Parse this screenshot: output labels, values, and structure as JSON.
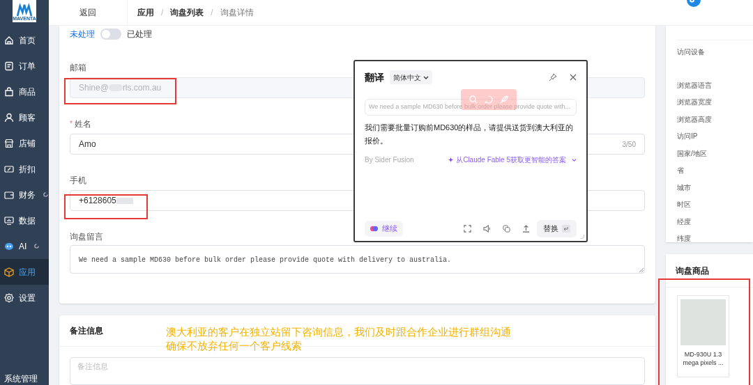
{
  "sidebar": {
    "logo": "MAVENTA",
    "items": [
      {
        "label": "首页",
        "kind": "home",
        "selected": false,
        "loading": false
      },
      {
        "label": "订单",
        "kind": "order",
        "selected": false,
        "loading": false
      },
      {
        "label": "商品",
        "kind": "bag",
        "selected": false,
        "loading": false
      },
      {
        "label": "顾客",
        "kind": "user",
        "selected": false,
        "loading": false
      },
      {
        "label": "店铺",
        "kind": "shop",
        "selected": false,
        "loading": false
      },
      {
        "label": "折扣",
        "kind": "discount",
        "selected": false,
        "loading": false
      },
      {
        "label": "财务",
        "kind": "wallet",
        "selected": false,
        "loading": true
      },
      {
        "label": "数据",
        "kind": "monitor",
        "selected": false,
        "loading": false
      },
      {
        "label": "AI",
        "kind": "robot",
        "selected": false,
        "loading": true
      },
      {
        "label": "应用",
        "kind": "cube",
        "selected": true,
        "loading": false
      },
      {
        "label": "设置",
        "kind": "gear",
        "selected": false,
        "loading": false
      }
    ],
    "footer": "系统管理"
  },
  "header": {
    "back": "返回",
    "separator": "/",
    "breadcrumb": [
      {
        "label": "应用",
        "current": false
      },
      {
        "label": "询盘列表",
        "current": false
      },
      {
        "label": "询盘详情",
        "current": true
      }
    ]
  },
  "status_switch": {
    "off_label": "未处理",
    "on_label": "已处理",
    "on": false
  },
  "form": {
    "email": {
      "label": "邮箱",
      "value_start": "Shine@",
      "value_end": "rls.com.au",
      "disabled": true
    },
    "name": {
      "label": "姓名",
      "required_mark": "*",
      "value": "Amo",
      "counter": "3/50"
    },
    "phone": {
      "label": "手机",
      "value_start": "+6128605"
    },
    "message": {
      "label": "询盘留言",
      "value": "We need a sample MD630 before bulk order please provide quote with delivery to australia."
    }
  },
  "notes": {
    "title": "备注信息",
    "placeholder": "备注信息"
  },
  "visit_info": {
    "items": [
      "访问设备",
      "浏览器语言",
      "浏览器宽度",
      "浏览器高度",
      "访问IP",
      "国家/地区",
      "省",
      "城市",
      "时区",
      "经度",
      "纬度"
    ]
  },
  "product_panel": {
    "title": "询盘商品",
    "products": [
      {
        "name": "MD-930U 1.3 mega pixels ..."
      }
    ]
  },
  "translate_popup": {
    "title": "翻译",
    "language": "简体中文",
    "source": "We need a sample MD630 before bulk order please provide quote with...",
    "result": "我们需要批量订购前MD630的样品，请提供送货到澳大利亚的报价。",
    "credit": "By Sider Fusion",
    "upgrade": "从Claude Fable 5获取更智能的答案",
    "continue": "继续",
    "replace": "替换"
  },
  "annotation": {
    "lines": [
      "澳大利亚的客户在独立站留下咨询信息，我们及时跟合作企业进行群组沟通",
      "确保不放弃任何一个客户线索"
    ]
  }
}
